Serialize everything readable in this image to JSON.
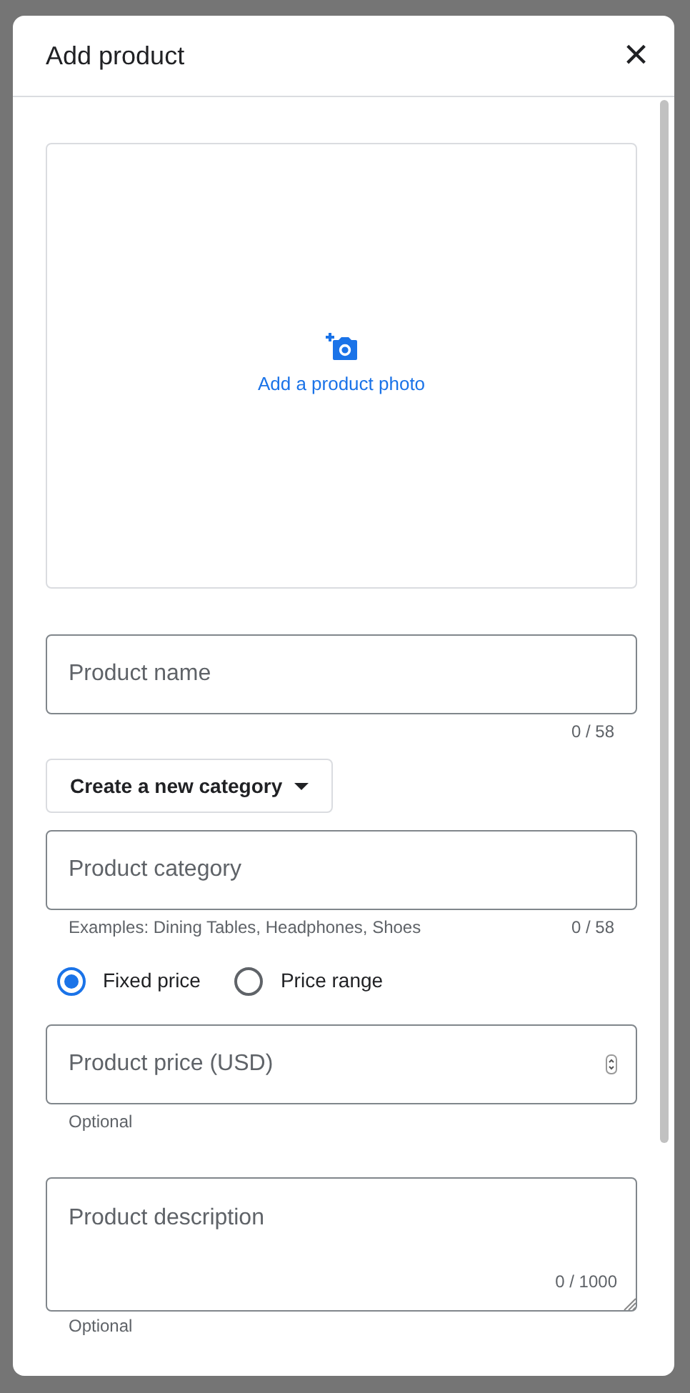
{
  "dialog": {
    "title": "Add product",
    "close": "×",
    "photo": {
      "label": "Add a product photo"
    },
    "fields": [
      {
        "kind": "text",
        "placeholder": "Product name",
        "counter": "0 / 58"
      },
      {
        "kind": "dropdown",
        "label": "Create a new category"
      },
      {
        "kind": "text",
        "placeholder": "Product category",
        "hint": "Examples: Dining Tables, Headphones, Shoes",
        "counter": "0 / 58"
      },
      {
        "kind": "radios",
        "options": [
          {
            "label": "Fixed price",
            "selected": true
          },
          {
            "label": "Price range",
            "selected": false
          }
        ]
      },
      {
        "kind": "number",
        "placeholder": "Product price (USD)",
        "hint": "Optional"
      },
      {
        "kind": "textarea",
        "placeholder": "Product description",
        "counter": "0 / 1000",
        "hint": "Optional"
      }
    ]
  }
}
